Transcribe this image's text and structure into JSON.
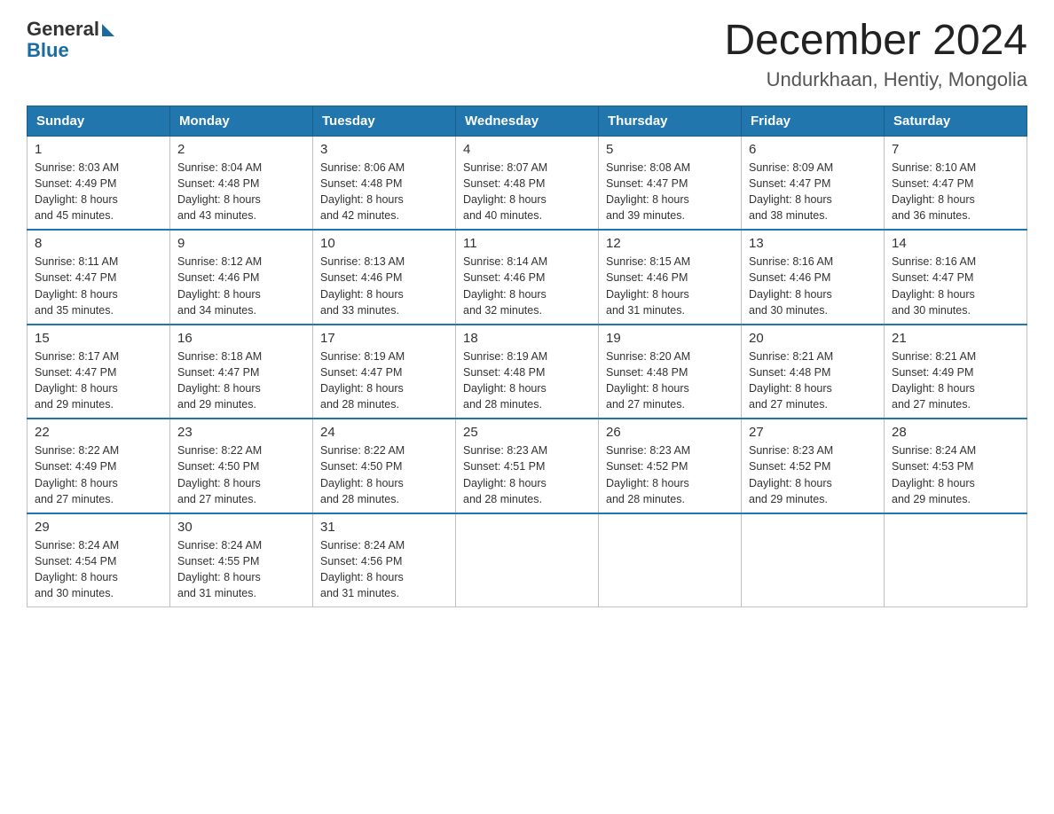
{
  "header": {
    "logo_general": "General",
    "logo_blue": "Blue",
    "month_year": "December 2024",
    "location": "Undurkhaan, Hentiy, Mongolia"
  },
  "days_of_week": [
    "Sunday",
    "Monday",
    "Tuesday",
    "Wednesday",
    "Thursday",
    "Friday",
    "Saturday"
  ],
  "weeks": [
    [
      {
        "date": "1",
        "sunrise": "8:03 AM",
        "sunset": "4:49 PM",
        "daylight": "8 hours and 45 minutes."
      },
      {
        "date": "2",
        "sunrise": "8:04 AM",
        "sunset": "4:48 PM",
        "daylight": "8 hours and 43 minutes."
      },
      {
        "date": "3",
        "sunrise": "8:06 AM",
        "sunset": "4:48 PM",
        "daylight": "8 hours and 42 minutes."
      },
      {
        "date": "4",
        "sunrise": "8:07 AM",
        "sunset": "4:48 PM",
        "daylight": "8 hours and 40 minutes."
      },
      {
        "date": "5",
        "sunrise": "8:08 AM",
        "sunset": "4:47 PM",
        "daylight": "8 hours and 39 minutes."
      },
      {
        "date": "6",
        "sunrise": "8:09 AM",
        "sunset": "4:47 PM",
        "daylight": "8 hours and 38 minutes."
      },
      {
        "date": "7",
        "sunrise": "8:10 AM",
        "sunset": "4:47 PM",
        "daylight": "8 hours and 36 minutes."
      }
    ],
    [
      {
        "date": "8",
        "sunrise": "8:11 AM",
        "sunset": "4:47 PM",
        "daylight": "8 hours and 35 minutes."
      },
      {
        "date": "9",
        "sunrise": "8:12 AM",
        "sunset": "4:46 PM",
        "daylight": "8 hours and 34 minutes."
      },
      {
        "date": "10",
        "sunrise": "8:13 AM",
        "sunset": "4:46 PM",
        "daylight": "8 hours and 33 minutes."
      },
      {
        "date": "11",
        "sunrise": "8:14 AM",
        "sunset": "4:46 PM",
        "daylight": "8 hours and 32 minutes."
      },
      {
        "date": "12",
        "sunrise": "8:15 AM",
        "sunset": "4:46 PM",
        "daylight": "8 hours and 31 minutes."
      },
      {
        "date": "13",
        "sunrise": "8:16 AM",
        "sunset": "4:46 PM",
        "daylight": "8 hours and 30 minutes."
      },
      {
        "date": "14",
        "sunrise": "8:16 AM",
        "sunset": "4:47 PM",
        "daylight": "8 hours and 30 minutes."
      }
    ],
    [
      {
        "date": "15",
        "sunrise": "8:17 AM",
        "sunset": "4:47 PM",
        "daylight": "8 hours and 29 minutes."
      },
      {
        "date": "16",
        "sunrise": "8:18 AM",
        "sunset": "4:47 PM",
        "daylight": "8 hours and 29 minutes."
      },
      {
        "date": "17",
        "sunrise": "8:19 AM",
        "sunset": "4:47 PM",
        "daylight": "8 hours and 28 minutes."
      },
      {
        "date": "18",
        "sunrise": "8:19 AM",
        "sunset": "4:48 PM",
        "daylight": "8 hours and 28 minutes."
      },
      {
        "date": "19",
        "sunrise": "8:20 AM",
        "sunset": "4:48 PM",
        "daylight": "8 hours and 27 minutes."
      },
      {
        "date": "20",
        "sunrise": "8:21 AM",
        "sunset": "4:48 PM",
        "daylight": "8 hours and 27 minutes."
      },
      {
        "date": "21",
        "sunrise": "8:21 AM",
        "sunset": "4:49 PM",
        "daylight": "8 hours and 27 minutes."
      }
    ],
    [
      {
        "date": "22",
        "sunrise": "8:22 AM",
        "sunset": "4:49 PM",
        "daylight": "8 hours and 27 minutes."
      },
      {
        "date": "23",
        "sunrise": "8:22 AM",
        "sunset": "4:50 PM",
        "daylight": "8 hours and 27 minutes."
      },
      {
        "date": "24",
        "sunrise": "8:22 AM",
        "sunset": "4:50 PM",
        "daylight": "8 hours and 28 minutes."
      },
      {
        "date": "25",
        "sunrise": "8:23 AM",
        "sunset": "4:51 PM",
        "daylight": "8 hours and 28 minutes."
      },
      {
        "date": "26",
        "sunrise": "8:23 AM",
        "sunset": "4:52 PM",
        "daylight": "8 hours and 28 minutes."
      },
      {
        "date": "27",
        "sunrise": "8:23 AM",
        "sunset": "4:52 PM",
        "daylight": "8 hours and 29 minutes."
      },
      {
        "date": "28",
        "sunrise": "8:24 AM",
        "sunset": "4:53 PM",
        "daylight": "8 hours and 29 minutes."
      }
    ],
    [
      {
        "date": "29",
        "sunrise": "8:24 AM",
        "sunset": "4:54 PM",
        "daylight": "8 hours and 30 minutes."
      },
      {
        "date": "30",
        "sunrise": "8:24 AM",
        "sunset": "4:55 PM",
        "daylight": "8 hours and 31 minutes."
      },
      {
        "date": "31",
        "sunrise": "8:24 AM",
        "sunset": "4:56 PM",
        "daylight": "8 hours and 31 minutes."
      },
      null,
      null,
      null,
      null
    ]
  ],
  "labels": {
    "sunrise": "Sunrise:",
    "sunset": "Sunset:",
    "daylight": "Daylight:"
  }
}
